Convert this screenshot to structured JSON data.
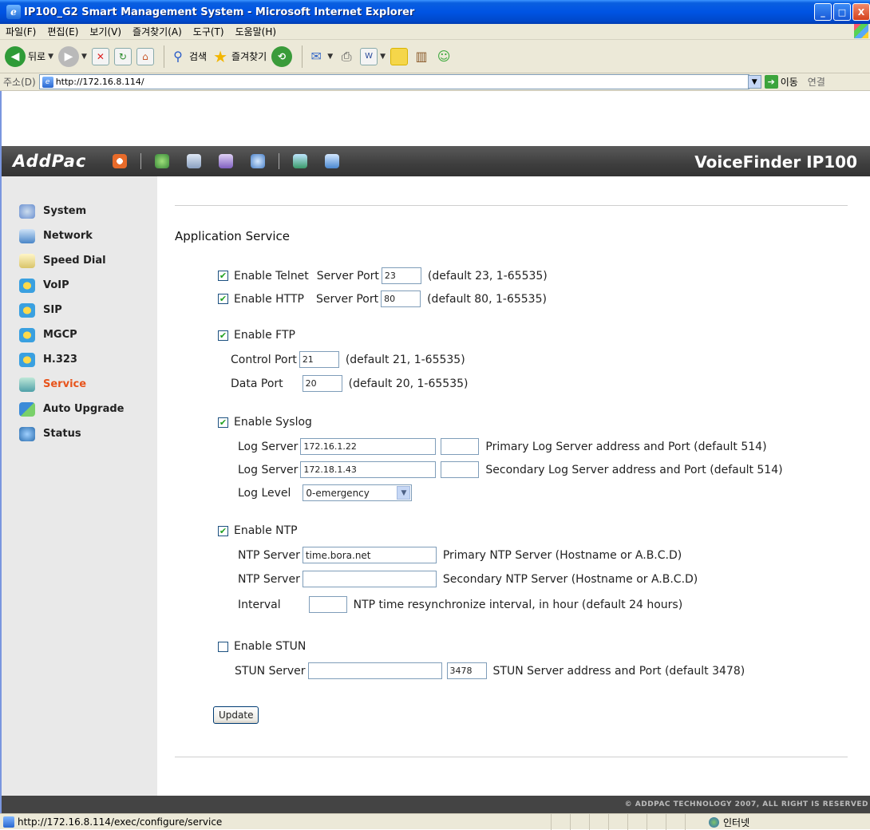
{
  "window": {
    "title": "IP100_G2 Smart Management System - Microsoft Internet Explorer",
    "controls": [
      "_",
      "□",
      "X"
    ]
  },
  "menu": [
    "파일(F)",
    "편집(E)",
    "보기(V)",
    "즐겨찾기(A)",
    "도구(T)",
    "도움말(H)"
  ],
  "toolbar": {
    "back_label": "뒤로",
    "search_label": "검색",
    "favorites_label": "즐겨찾기"
  },
  "address": {
    "label": "주소(D)",
    "url": "http://172.16.8.114/",
    "go_label": "이동",
    "links_label": "연결"
  },
  "header": {
    "brand": "AddPac",
    "product": "VoiceFinder IP100"
  },
  "sidebar": {
    "items": [
      {
        "label": "System",
        "icon": "system-icon",
        "color": "#6a8fd0"
      },
      {
        "label": "Network",
        "icon": "network-icon",
        "color": "#4a86c8"
      },
      {
        "label": "Speed Dial",
        "icon": "speed-dial-icon",
        "color": "#d9c46a"
      },
      {
        "label": "VoIP",
        "icon": "voip-icon",
        "color": "#3aa0e0"
      },
      {
        "label": "SIP",
        "icon": "sip-icon",
        "color": "#3aa0e0"
      },
      {
        "label": "MGCP",
        "icon": "mgcp-icon",
        "color": "#3aa0e0"
      },
      {
        "label": "H.323",
        "icon": "h323-icon",
        "color": "#3aa0e0"
      },
      {
        "label": "Service",
        "icon": "service-icon",
        "color": "#4fa0a8"
      },
      {
        "label": "Auto Upgrade",
        "icon": "auto-upgrade-icon",
        "color": "#3b8bd8"
      },
      {
        "label": "Status",
        "icon": "status-icon",
        "color": "#2d6fb0"
      }
    ],
    "active": "Service"
  },
  "main": {
    "section_title": "Application Service",
    "telnet": {
      "label": "Enable Telnet",
      "checked": true,
      "port_label": "Server Port",
      "port": "23",
      "hint": "(default 23, 1-65535)"
    },
    "http": {
      "label": "Enable HTTP",
      "checked": true,
      "port_label": "Server Port",
      "port": "80",
      "hint": "(default 80, 1-65535)"
    },
    "ftp": {
      "label": "Enable FTP",
      "checked": true,
      "control_label": "Control Port",
      "control_port": "21",
      "control_hint": "(default 21, 1-65535)",
      "data_label": "Data Port",
      "data_port": "20",
      "data_hint": "(default 20, 1-65535)"
    },
    "syslog": {
      "label": "Enable Syslog",
      "checked": true,
      "server1_label": "Log Server",
      "server1": "172.16.1.22",
      "server1_port": "",
      "server1_hint": "Primary Log Server address and Port (default 514)",
      "server2_label": "Log Server",
      "server2": "172.18.1.43",
      "server2_port": "",
      "server2_hint": "Secondary Log Server address and Port (default 514)",
      "level_label": "Log Level",
      "level": "0-emergency"
    },
    "ntp": {
      "label": "Enable NTP",
      "checked": true,
      "server1_label": "NTP Server",
      "server1": "time.bora.net",
      "server1_hint": "Primary NTP Server (Hostname or A.B.C.D)",
      "server2_label": "NTP Server",
      "server2": "",
      "server2_hint": "Secondary NTP Server (Hostname or A.B.C.D)",
      "interval_label": "Interval",
      "interval": "",
      "interval_hint": "NTP time resynchronize interval, in hour (default 24 hours)"
    },
    "stun": {
      "label": "Enable STUN",
      "checked": false,
      "server_label": "STUN Server",
      "server": "",
      "port": "3478",
      "hint": "STUN Server address and Port (default 3478)"
    },
    "update_label": "Update"
  },
  "footer": "© ADDPAC TECHNOLOGY 2007, ALL RIGHT IS RESERVED",
  "status": {
    "url": "http://172.16.8.114/exec/configure/service",
    "zone": "인터넷"
  },
  "colors": {
    "accent_active": "#e8541c",
    "banner": "#3e3e3e",
    "sidebar_bg": "#e9e9e9",
    "titlebar": "#0054e3"
  }
}
